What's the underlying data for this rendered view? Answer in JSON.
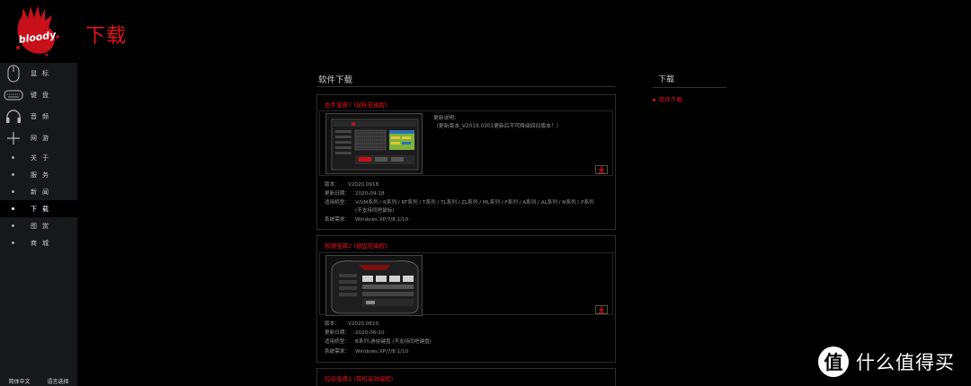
{
  "header": {
    "logo_text": "bloody",
    "title": "下载"
  },
  "sidebar": {
    "items": [
      {
        "label": "鼠标",
        "icon": "mouse-icon"
      },
      {
        "label": "键盘",
        "icon": "keyboard-icon"
      },
      {
        "label": "音频",
        "icon": "headset-icon"
      },
      {
        "label": "网游",
        "icon": "plus-icon"
      },
      {
        "label": "关于"
      },
      {
        "label": "服务"
      },
      {
        "label": "新闻"
      },
      {
        "label": "下载",
        "active": true
      },
      {
        "label": "图赏"
      },
      {
        "label": "商城"
      }
    ],
    "footer": {
      "left": "简体中文",
      "right": "语言选择"
    }
  },
  "main": {
    "section_title": "软件下载",
    "cards": [
      {
        "title": "血手宝典7 (鼠标宏编程)",
        "notes_label": "更新说明：",
        "notes_text": "（更新版本_V2019.0301更新后不可降级回旧版本！）",
        "version_label": "版本：",
        "version": "V2020.0918",
        "date_label": "更新日期：",
        "date": "2020-09-18",
        "models_label": "适用机型：",
        "models": "V/VM系列 / R系列 / RT系列 / T系列 / TL系列 / ZL系列 / ML系列 / F系列 / A系列 / AL系列 / N系列 / P系列",
        "models_note": "(不支持同吧鼠标)",
        "req_label": "系统需求：",
        "req": "Windows XP/7/8.1/10"
      },
      {
        "title": "按键宝典2 (键盘宏编程)",
        "version_label": "版本：",
        "version": "V2020.0610",
        "date_label": "更新日期：",
        "date": "2020-06-10",
        "models_label": "适用机型：",
        "models": "B系列-游侠键盘 (不支持同吧键盘)",
        "req_label": "系统需求：",
        "req": "Windows XP/7/8.1/10"
      },
      {
        "title": "控音宝典1 (耳机音效编程)"
      }
    ]
  },
  "right": {
    "title": "下载",
    "link": "软件下载"
  },
  "watermark": {
    "glyph": "值",
    "text": "什么值得买"
  },
  "colors": {
    "accent": "#e8121a",
    "sidebar_bg": "#17181a",
    "page_bg": "#000000"
  }
}
